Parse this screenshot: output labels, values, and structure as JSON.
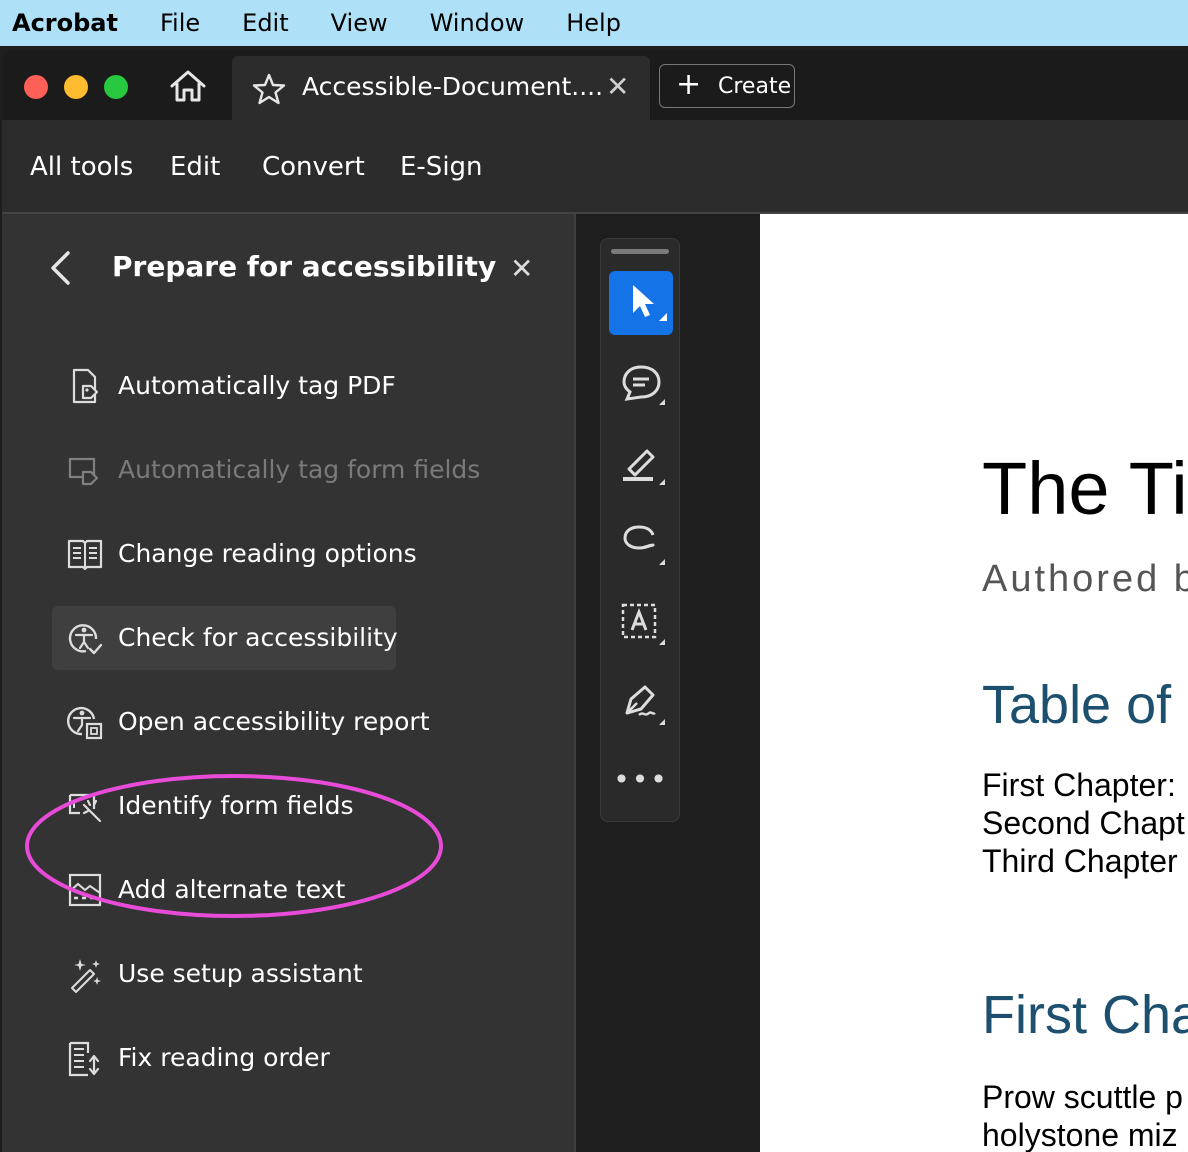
{
  "menubar": {
    "app": "Acrobat",
    "items": [
      "File",
      "Edit",
      "View",
      "Window",
      "Help"
    ]
  },
  "tab": {
    "title": "Accessible-Document...."
  },
  "create_label": "Create",
  "toolbar": [
    "All tools",
    "Edit",
    "Convert",
    "E-Sign"
  ],
  "panel": {
    "title": "Prepare for accessibility",
    "items": [
      {
        "label": "Automatically tag PDF",
        "icon": "tag-pdf-icon",
        "disabled": false
      },
      {
        "label": "Automatically tag form fields",
        "icon": "tag-form-fields-icon",
        "disabled": true
      },
      {
        "label": "Change reading options",
        "icon": "book-icon",
        "disabled": false
      },
      {
        "label": "Check for accessibility",
        "icon": "accessibility-check-icon",
        "disabled": false,
        "highlighted": true
      },
      {
        "label": "Open accessibility report",
        "icon": "accessibility-report-icon",
        "disabled": false
      },
      {
        "label": "Identify form fields",
        "icon": "identify-form-fields-icon",
        "disabled": false
      },
      {
        "label": "Add alternate text",
        "icon": "image-alt-text-icon",
        "disabled": false
      },
      {
        "label": "Use setup assistant",
        "icon": "magic-wand-icon",
        "disabled": false
      },
      {
        "label": "Fix reading order",
        "icon": "reading-order-icon",
        "disabled": false
      }
    ]
  },
  "rail": [
    "select-cursor-icon",
    "comment-icon",
    "highlight-pen-icon",
    "lasso-icon",
    "text-recognition-icon",
    "sign-pen-icon"
  ],
  "document": {
    "title": "The Tit",
    "author": "Authored b",
    "toc_heading": "Table of C",
    "toc": [
      "First Chapter:",
      "Second Chapt",
      "Third Chapter"
    ],
    "chapter_heading": "First Cha",
    "body": [
      "Prow scuttle p",
      "holystone miz"
    ]
  },
  "colors": {
    "menubar": "#aee1f7",
    "accent": "#1473e6",
    "annotation": "#e84bd8",
    "heading": "#1d4f6e"
  }
}
